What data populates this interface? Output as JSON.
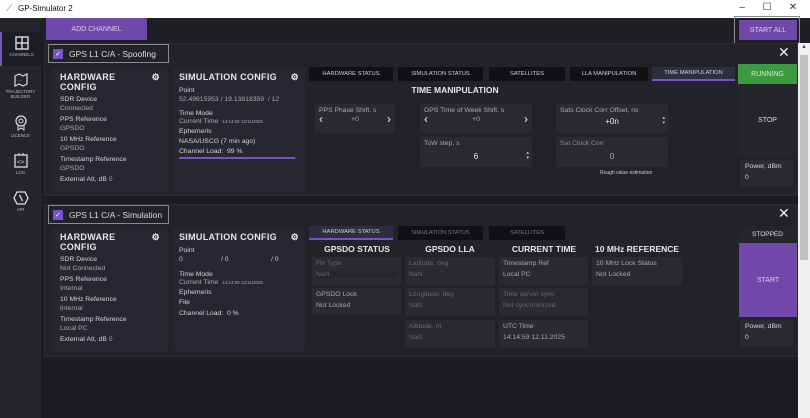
{
  "app": {
    "title": "GP-Simulator 2"
  },
  "window": {
    "minimize": "–",
    "maximize": "☐",
    "close": "✕"
  },
  "sidebar": {
    "items": [
      {
        "label": "CHANNELS",
        "icon": "grid-icon",
        "active": true
      },
      {
        "label": "TRAJECTORY BUILDER",
        "icon": "map-icon"
      },
      {
        "label": "LICENCE",
        "icon": "badge-icon"
      },
      {
        "label": "LOG",
        "icon": "code-icon"
      },
      {
        "label": "API",
        "icon": "hexagon-slash-icon"
      }
    ]
  },
  "toolbar": {
    "add_channel": "ADD CHANNEL",
    "start_all": "START ALL"
  },
  "channels": [
    {
      "name": "GPS L1 C/A - Spoofing",
      "checked": true,
      "hardware": {
        "title": "HARDWARE CONFIG",
        "sdr_label": "SDR Device",
        "sdr": "Connected",
        "pps_label": "PPS Reference",
        "pps": "GPSDO",
        "ref_label": "10 MHz Reference",
        "ref": "GPSDO",
        "ts_label": "Timestamp Reference",
        "ts": "GPSDO",
        "att_label": "External Att, dB",
        "att": "0"
      },
      "simulation": {
        "title": "SIMULATION CONFIG",
        "point_label": "Point",
        "lat": "52.49615953",
        "lon": "/ 19.13818359",
        "alt": "/ 12",
        "time_mode_label": "Time Mode",
        "time_mode": "Current Time",
        "time": "14:14:59  12/11/2025",
        "eph_label": "Ephemeris",
        "eph": "NASA/USCG (7 min ago)",
        "load_label": "Channel Load:",
        "load": "99 %",
        "load_pct": 99
      },
      "tabs": [
        "HARDWARE STATUS",
        "SIMULATION STATUS",
        "SATELLITES",
        "LLA MANIPULATION",
        "TIME MANIPULATION"
      ],
      "active_tab": "TIME MANIPULATION",
      "time_manip": {
        "title": "TIME MANIPULATION",
        "pps_label": "PPS Phase Shift, s",
        "pps": "+0",
        "tow_label": "GPS Time of Week Shift, s",
        "tow": "+0",
        "tow_step_label": "ToW step, s",
        "tow_step": "6",
        "sats_offset_label": "Sats Clock Corr Offset, ns",
        "sats_offset": "+0n",
        "sat_corr_label": "Sat Clock Corr",
        "sat_corr": "0",
        "note": "Rough value estimation"
      },
      "status": "RUNNING",
      "status_color": "#3e9a3e",
      "action": "STOP",
      "power_label": "Power, dBm",
      "power": "0"
    },
    {
      "name": "GPS L1 C/A - Simulation",
      "checked": true,
      "hardware": {
        "title": "HARDWARE CONFIG",
        "sdr_label": "SDR Device",
        "sdr": "Not Connected",
        "pps_label": "PPS Reference",
        "pps": "Internal",
        "ref_label": "10 MHz Reference",
        "ref": "Internal",
        "ts_label": "Timestamp Reference",
        "ts": "Local PC",
        "att_label": "External Att, dB",
        "att": "0"
      },
      "simulation": {
        "title": "SIMULATION CONFIG",
        "point_label": "Point",
        "lat": "0",
        "lon": "/ 0",
        "alt": "/ 0",
        "time_mode_label": "Time Mode",
        "time_mode": "Current Time",
        "time": "14:14:59  12/11/2025",
        "eph_label": "Ephemeris",
        "eph": "File",
        "load_label": "Channel Load:",
        "load": "0 %",
        "load_pct": 0
      },
      "tabs": [
        "HARDWARE STATUS",
        "SIMULATION STATUS",
        "SATELLITES"
      ],
      "active_tab": "HARDWARE STATUS",
      "hw_status": {
        "gpsdo": {
          "title": "GPSDO STATUS",
          "fix_label": "Fix Type",
          "fix": "NaN",
          "lock_label": "GPSDO Lock",
          "lock": "Not Locked"
        },
        "lla": {
          "title": "GPSDO LLA",
          "lat_label": "Latitude, deg",
          "lat": "NaN",
          "lon_label": "Longitude, deg",
          "lon": "NaN",
          "alt_label": "Altitude, m",
          "alt": "NaN"
        },
        "time": {
          "title": "CURRENT TIME",
          "ts_label": "Timestamp Ref",
          "ts": "Local PC",
          "sync_label": "Time server sync",
          "sync": "Not synchronized",
          "utc_label": "UTC Time",
          "utc": "14:14:59 12.11.2025"
        },
        "ref": {
          "title": "10 MHz REFERENCE",
          "lock_label": "10 MHz Lock Status",
          "lock": "Not Locked"
        }
      },
      "status": "STOPPED",
      "action": "START",
      "power_label": "Power, dBm",
      "power": "0"
    }
  ]
}
